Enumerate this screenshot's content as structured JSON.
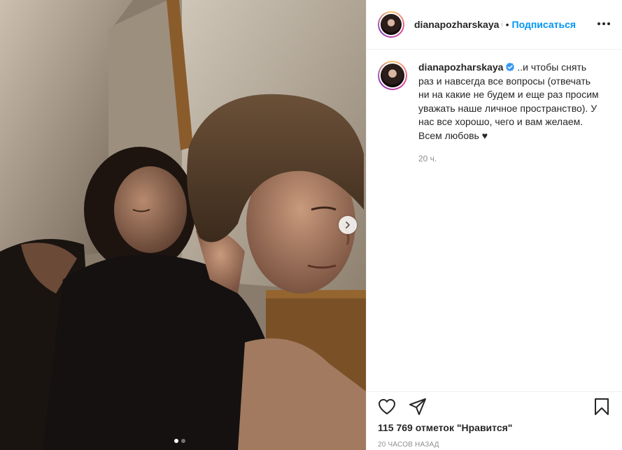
{
  "post": {
    "username": "dianapozharskaya",
    "header_trail": "і",
    "separator": "•",
    "follow_label": "Подписаться",
    "caption": "..и чтобы снять раз и навсегда все вопросы (отвечать ни на какие не будем и еще раз просим уважать наше личное пространство). У нас все хорошо, чего и вам желаем.",
    "caption_line2": "Всем любовь ♥",
    "comment_time": "20 ч.",
    "likes": "115 769 отметок \"Нравится\"",
    "posted_ago": "20 часов назад"
  },
  "carousel": {
    "total": 2,
    "current": 1
  },
  "colors": {
    "link_blue": "#0095f6",
    "text": "#262626",
    "muted": "#8e8e8e",
    "divider": "#efefef"
  },
  "icons": [
    "verified-icon",
    "more-icon",
    "heart-icon",
    "share-icon",
    "bookmark-icon",
    "chevron-right-icon"
  ]
}
